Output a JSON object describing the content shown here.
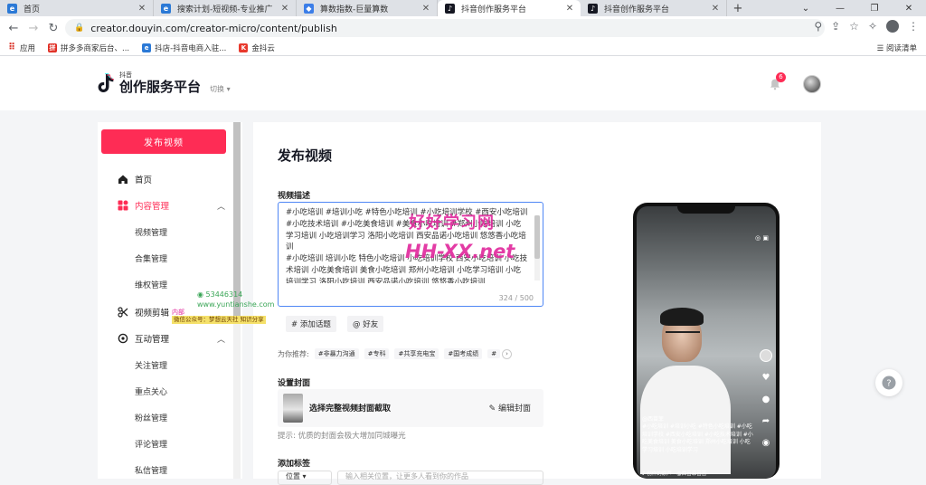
{
  "browser": {
    "tabs": [
      {
        "title": "首页",
        "icon": "blue-e-icon",
        "color": "#2b79d6",
        "active": false
      },
      {
        "title": "搜索计划-短视频-专业推广",
        "icon": "blue-e-icon",
        "color": "#2b79d6",
        "active": false
      },
      {
        "title": "算数指数-巨量算数",
        "icon": "layers-icon",
        "color": "#3c7ee8",
        "active": false
      },
      {
        "title": "抖音创作服务平台",
        "icon": "douyin-icon",
        "color": "#161823",
        "active": true
      },
      {
        "title": "抖音创作服务平台",
        "icon": "douyin-icon",
        "color": "#161823",
        "active": false
      }
    ],
    "new_tab": "+",
    "url": "creator.douyin.com/creator-micro/content/publish",
    "bookmarks": [
      {
        "label": "应用",
        "icon": "apps-grid-icon"
      },
      {
        "label": "拼多多商家后台、...",
        "icon": "pdd-icon"
      },
      {
        "label": "抖店-抖音电商入驻...",
        "icon": "doudian-icon"
      },
      {
        "label": "金抖云",
        "icon": "jindouyun-icon"
      }
    ],
    "reading_list": "阅读清单"
  },
  "header": {
    "logo_small": "抖音",
    "logo_big": "创作服务平台",
    "switch": "切换",
    "notification_count": "6"
  },
  "sidebar": {
    "publish_button": "发布视频",
    "items": [
      {
        "label": "首页",
        "icon": "home-icon",
        "type": "main"
      },
      {
        "label": "内容管理",
        "icon": "grid-icon",
        "type": "main-active"
      },
      {
        "label": "视频管理",
        "type": "sub"
      },
      {
        "label": "合集管理",
        "type": "sub"
      },
      {
        "label": "维权管理",
        "type": "sub"
      },
      {
        "label": "视频剪辑",
        "icon": "scissors-icon",
        "type": "main"
      },
      {
        "label": "互动管理",
        "icon": "interact-icon",
        "type": "main"
      },
      {
        "label": "关注管理",
        "type": "sub"
      },
      {
        "label": "重点关心",
        "type": "sub"
      },
      {
        "label": "粉丝管理",
        "type": "sub"
      },
      {
        "label": "评论管理",
        "type": "sub"
      },
      {
        "label": "私信管理",
        "type": "sub"
      }
    ]
  },
  "main": {
    "title": "发布视频",
    "desc_label": "视频描述",
    "description": "#小吃培训 #培训小吃 #特色小吃培训 #小吃培训学校 #西安小吃培训 #小吃技术培训 #小吃美食培训 #美食小吃培训 #郑州小吃培训 小吃学习培训 小吃培训学习 洛阳小吃培训 西安品诺小吃培训 悠悠香小吃培训\n#小吃培训 培训小吃 特色小吃培训 小吃培训学校 西安小吃培训 小吃技术培训 小吃美食培训 美食小吃培训 郑州小吃培训 小吃学习培训 小吃培训学习 洛阳小吃培训 西安品诺小吃培训 悠悠香小吃培训",
    "desc_count": "324 / 500",
    "add_topic": "# 添加话题",
    "at_friend": "@ 好友",
    "recommend_label": "为你推荐:",
    "recommend_tags": [
      "#非暴力沟通",
      "#专科",
      "#共享充电宝",
      "#国考成绩",
      "#"
    ],
    "cover_label": "设置封面",
    "cover_select": "选择完整视频封面截取",
    "cover_edit": "编辑封面",
    "cover_hint": "提示: 优质的封面会极大增加同城曝光",
    "tags_label": "添加标签",
    "tag_select": "位置",
    "tag_input_placeholder": "输入相关位置，让更多人看到你的作品"
  },
  "preview": {
    "caption": "@西苗菲\n#小吃培训 #培训小吃 #特色小吃培训 #小吃培训学校 #西安小吃培训 #小吃技术培训 #小吃美食培训 美食小吃培训 郑州小吃培训 小吃学习培训 小吃培训学习",
    "music": "♪ 创作的原声 - @西苗菲苗苗",
    "top_icons": "◎ ▣"
  },
  "watermark": {
    "line1": "好好学习网",
    "line2": "HH-XX.net",
    "qq": "53446314",
    "site": "www.yuntianshe.com",
    "tag": "内部",
    "note": "微信公众号：梦想云天社 知识分享"
  },
  "colors": {
    "brand_red": "#fe2c55",
    "focus_blue": "#4f87f5",
    "watermark_pink": "#e0279c"
  }
}
